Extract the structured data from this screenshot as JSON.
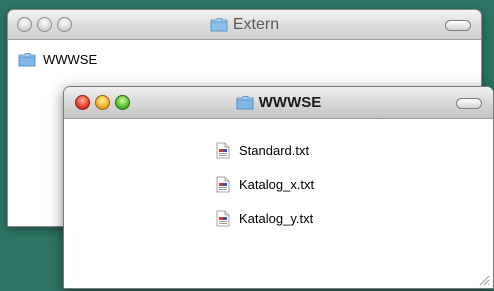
{
  "back_window": {
    "title": "Extern",
    "items": [
      {
        "label": "WWWSE",
        "icon": "folder-icon"
      }
    ]
  },
  "front_window": {
    "title": "WWWSE",
    "files": [
      {
        "label": "Standard.txt",
        "icon": "text-document-icon"
      },
      {
        "label": "Katalog_x.txt",
        "icon": "text-document-icon"
      },
      {
        "label": "Katalog_y.txt",
        "icon": "text-document-icon"
      }
    ]
  },
  "colors": {
    "desktop": "#2f7565",
    "close": "#e9432e",
    "minimize": "#f5b625",
    "zoom": "#5fc132",
    "folder": "#7fb8e6"
  }
}
